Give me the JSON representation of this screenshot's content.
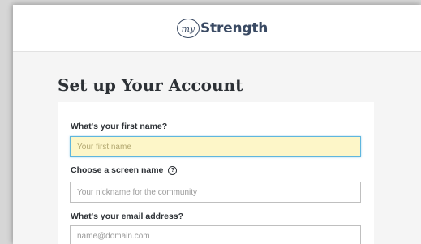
{
  "header": {
    "logo_badge": "my",
    "logo_word": "Strength"
  },
  "form": {
    "title": "Set up Your Account",
    "fields": [
      {
        "label": "What's your first name?",
        "placeholder": "Your first name",
        "value": ""
      },
      {
        "label": "Choose a screen name",
        "help_icon": "?",
        "placeholder": "Your nickname for the community",
        "value": ""
      },
      {
        "label": "What's your email address?",
        "placeholder": "name@domain.com",
        "value": ""
      }
    ]
  },
  "colors": {
    "brand": "#3a4a63",
    "focus_border": "#5fb6de",
    "focus_background": "#fdf6c8"
  }
}
